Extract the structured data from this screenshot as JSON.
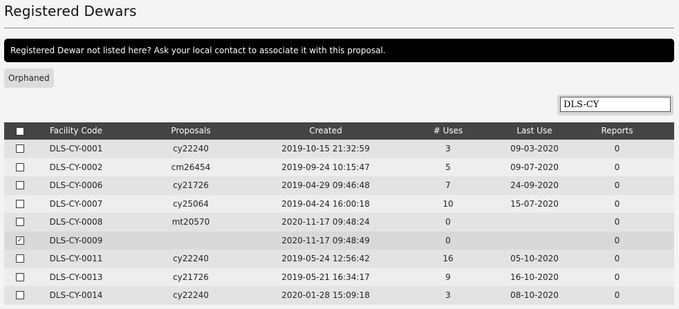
{
  "page": {
    "title": "Registered Dewars",
    "notice": "Registered Dewar not listed here? Ask your local contact to associate it with this proposal."
  },
  "toolbar": {
    "orphaned_label": "Orphaned"
  },
  "search": {
    "value": "DLS-CY"
  },
  "table": {
    "columns": [
      "Facility Code",
      "Proposals",
      "Created",
      "# Uses",
      "Last Use",
      "Reports"
    ],
    "rows": [
      {
        "checked": false,
        "facility_code": "DLS-CY-0001",
        "proposals": "cy22240",
        "created": "2019-10-15 21:32:59",
        "uses": "3",
        "last_use": "09-03-2020",
        "reports": "0"
      },
      {
        "checked": false,
        "facility_code": "DLS-CY-0002",
        "proposals": "cm26454",
        "created": "2019-09-24 10:15:47",
        "uses": "5",
        "last_use": "09-07-2020",
        "reports": "0"
      },
      {
        "checked": false,
        "facility_code": "DLS-CY-0006",
        "proposals": "cy21726",
        "created": "2019-04-29 09:46:48",
        "uses": "7",
        "last_use": "24-09-2020",
        "reports": "0"
      },
      {
        "checked": false,
        "facility_code": "DLS-CY-0007",
        "proposals": "cy25064",
        "created": "2019-04-24 16:00:18",
        "uses": "10",
        "last_use": "15-07-2020",
        "reports": "0"
      },
      {
        "checked": false,
        "facility_code": "DLS-CY-0008",
        "proposals": "mt20570",
        "created": "2020-11-17 09:48:24",
        "uses": "0",
        "last_use": "",
        "reports": "0"
      },
      {
        "checked": true,
        "facility_code": "DLS-CY-0009",
        "proposals": "",
        "created": "2020-11-17 09:48:49",
        "uses": "0",
        "last_use": "",
        "reports": "0"
      },
      {
        "checked": false,
        "facility_code": "DLS-CY-0011",
        "proposals": "cy22240",
        "created": "2019-05-24 12:56:42",
        "uses": "16",
        "last_use": "05-10-2020",
        "reports": "0"
      },
      {
        "checked": false,
        "facility_code": "DLS-CY-0013",
        "proposals": "cy21726",
        "created": "2019-05-21 16:34:17",
        "uses": "9",
        "last_use": "16-10-2020",
        "reports": "0"
      },
      {
        "checked": false,
        "facility_code": "DLS-CY-0014",
        "proposals": "cy22240",
        "created": "2020-01-28 15:09:18",
        "uses": "3",
        "last_use": "08-10-2020",
        "reports": "0"
      }
    ]
  }
}
